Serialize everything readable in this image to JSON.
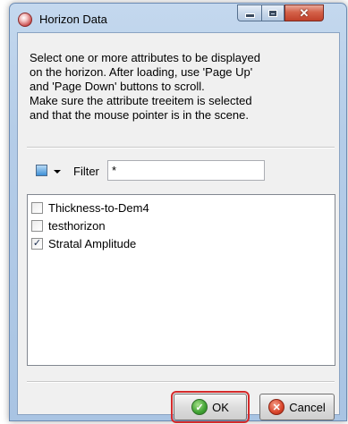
{
  "window": {
    "title": "Horizon Data",
    "icon": "app-logo-icon",
    "controls": {
      "minimize": "minimize-icon",
      "maximize": "maximize-icon",
      "close": "close-icon"
    }
  },
  "message": "Select one or more attributes to be displayed\non the horizon. After loading, use 'Page Up'\nand 'Page Down' buttons to scroll.\nMake sure the attribute treeitem is selected\nand that the mouse pointer is in the scene.",
  "toolbar": {
    "select_icon": "select-all-icon",
    "filter_label": "Filter",
    "filter_value": "*"
  },
  "attributes": [
    {
      "label": "Thickness-to-Dem4",
      "checked": false
    },
    {
      "label": "testhorizon",
      "checked": false
    },
    {
      "label": "Stratal Amplitude",
      "checked": true
    }
  ],
  "buttons": {
    "ok_label": "OK",
    "cancel_label": "Cancel"
  },
  "colors": {
    "highlight_border": "#d52a2a",
    "ok_icon": "#3fa233",
    "cancel_icon": "#d9442a"
  }
}
